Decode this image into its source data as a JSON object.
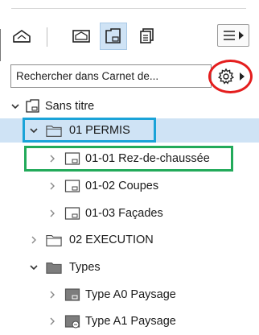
{
  "search": {
    "placeholder": "Rechercher dans Carnet de..."
  },
  "tree": {
    "root": {
      "label": "Sans titre"
    },
    "items": [
      {
        "label": "01 PERMIS"
      },
      {
        "label": "01-01 Rez-de-chaussée"
      },
      {
        "label": "01-02 Coupes"
      },
      {
        "label": "01-03 Façades"
      },
      {
        "label": "02 EXECUTION"
      },
      {
        "label": "Types"
      },
      {
        "label": "Type A0 Paysage"
      },
      {
        "label": "Type A1 Paysage"
      }
    ]
  },
  "colors": {
    "selection": "#cfe3f5",
    "highlight_blue": "#1aa3d8",
    "highlight_green": "#22aa5a",
    "highlight_red": "#e41d1d"
  },
  "icons": {
    "toolbar": [
      "project-map-icon",
      "view-map-icon",
      "layout-book-icon",
      "publisher-sets-icon",
      "menu-icon"
    ],
    "settings": "gear-icon"
  }
}
